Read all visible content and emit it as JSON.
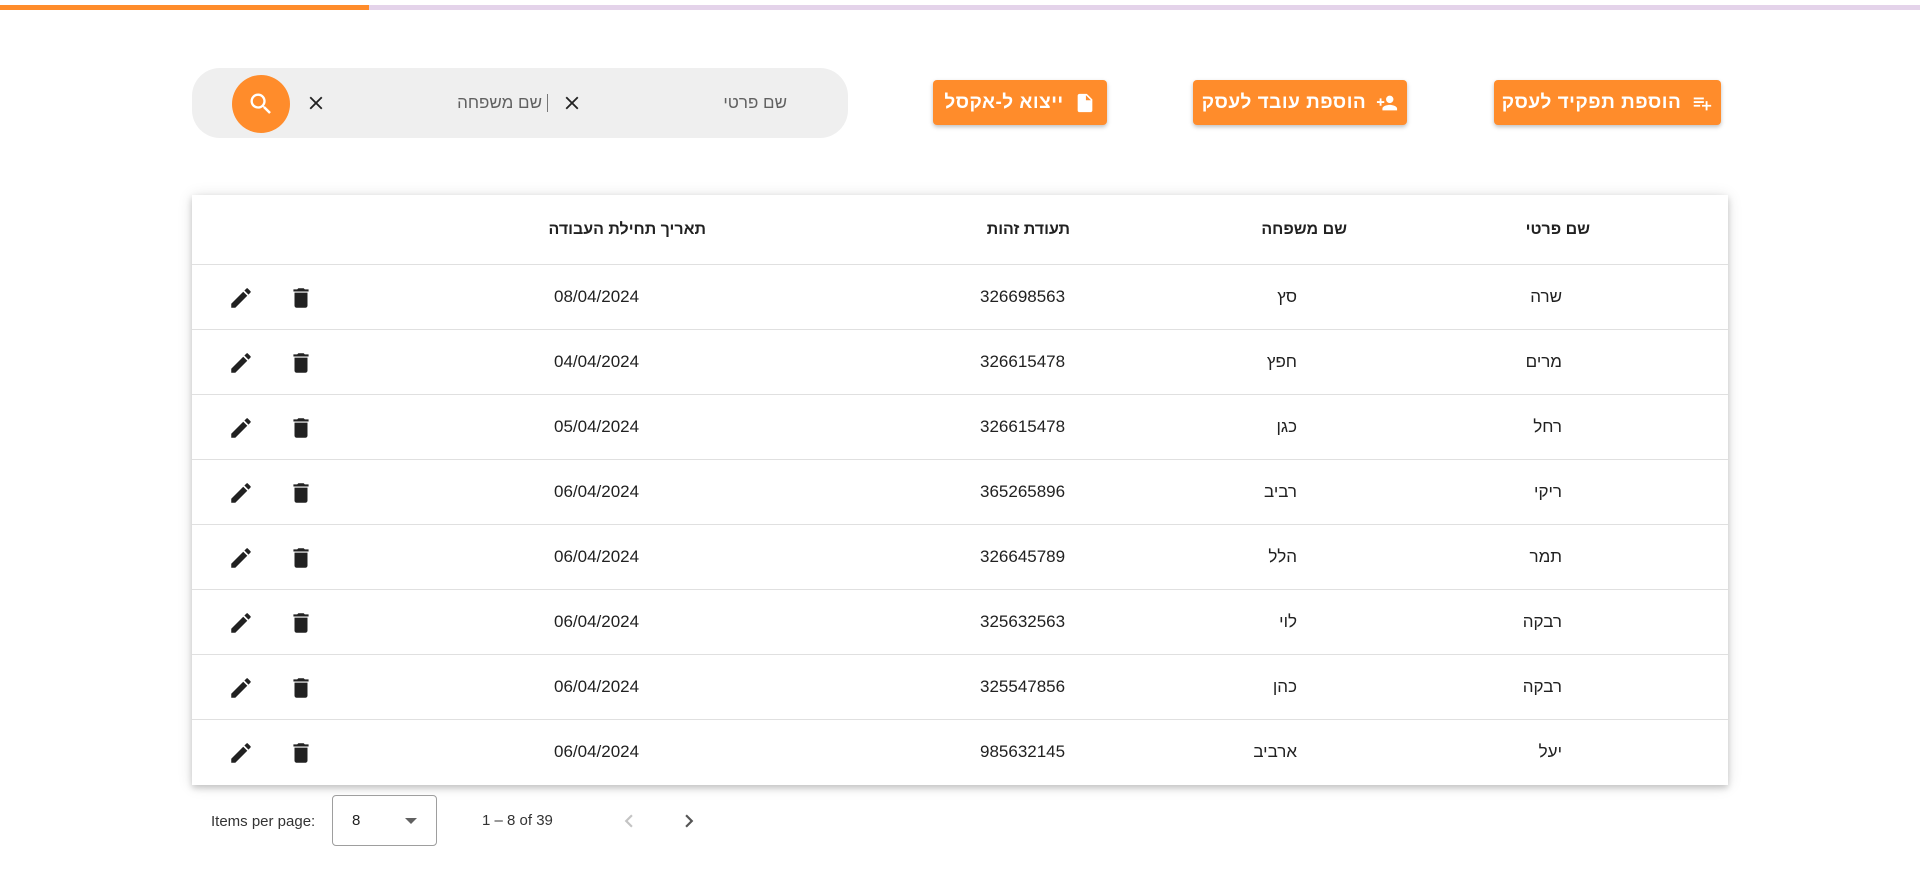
{
  "progress": {
    "fraction": 0.2,
    "fill_color": "#ff8c2b",
    "track_color": "#e4d3ea"
  },
  "search": {
    "first_name_placeholder": "שם פרטי",
    "last_name_placeholder": "שם משפחה",
    "icon": "search-icon",
    "clear_icon": "close-icon"
  },
  "actions": {
    "export_label": "ייצוא ל-אקסל",
    "export_icon": "file-icon",
    "add_employee_label": "הוספת עובד לעסק",
    "add_employee_icon": "person-add-icon",
    "add_role_label": "הוספת תפקיד לעסק",
    "add_role_icon": "playlist-add-icon",
    "accent_color": "#ff8c2b"
  },
  "table": {
    "headers": {
      "first_name": "שם פרטי",
      "last_name": "שם משפחה",
      "id_number": "תעודת זהות",
      "start_date": "תאריך תחילת העבודה"
    },
    "rows": [
      {
        "first_name": "שרה",
        "last_name": "סץ",
        "id_number": "326698563",
        "start_date": "08/04/2024"
      },
      {
        "first_name": "מרים",
        "last_name": "חפץ",
        "id_number": "326615478",
        "start_date": "04/04/2024"
      },
      {
        "first_name": "רחל",
        "last_name": "כגן",
        "id_number": "326615478",
        "start_date": "05/04/2024"
      },
      {
        "first_name": "ריקי",
        "last_name": "רביב",
        "id_number": "365265896",
        "start_date": "06/04/2024"
      },
      {
        "first_name": "תמר",
        "last_name": "הלל",
        "id_number": "326645789",
        "start_date": "06/04/2024"
      },
      {
        "first_name": "רבקה",
        "last_name": "לוי",
        "id_number": "325632563",
        "start_date": "06/04/2024"
      },
      {
        "first_name": "רבקה",
        "last_name": "כהן",
        "id_number": "325547856",
        "start_date": "06/04/2024"
      },
      {
        "first_name": "יעל",
        "last_name": "ארביב",
        "id_number": "985632145",
        "start_date": "06/04/2024"
      }
    ],
    "row_actions": {
      "edit_icon": "pencil-icon",
      "delete_icon": "trash-icon"
    }
  },
  "pagination": {
    "items_per_page_label": "Items per page:",
    "items_per_page_value": "8",
    "range_label": "1 – 8 of 39",
    "prev_icon": "chevron-left-icon",
    "next_icon": "chevron-right-icon"
  }
}
